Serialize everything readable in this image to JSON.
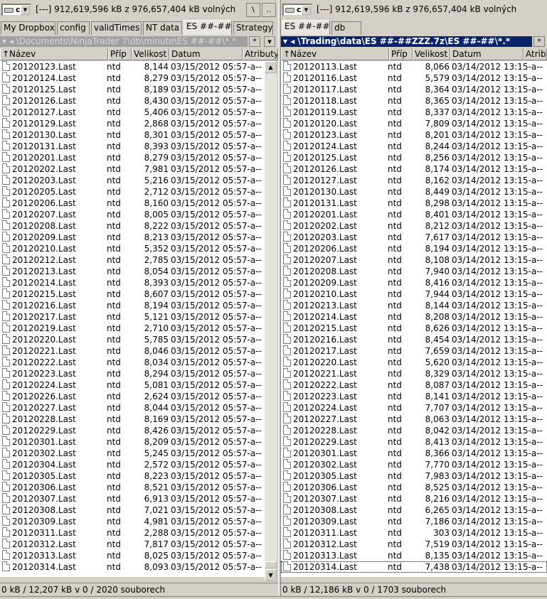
{
  "left": {
    "drive": "c",
    "drive_info": "[---]  912,619,596 kB z 976,657,404 kB volných",
    "btn_root": "\\",
    "btn_up": "..",
    "tabs": [
      "My Dropbox",
      "config",
      "validTimes",
      "NT data",
      "ES ##-##",
      "Strategy"
    ],
    "active_tab": 4,
    "path": "▾ ◂ \\Documents\\NinjaTrader 7\\db\\minute\\ES ##-##\\*.*",
    "btn_star": "*",
    "btn_dropdown": "▾",
    "headers": {
      "name": "↑Název",
      "ext": "Příp",
      "size": "Velikost",
      "date": "Datum",
      "attr": "Atributy"
    },
    "rows": [
      [
        "20120123.Last",
        "ntd",
        "8,144",
        "03/15/2012 05:57-a--"
      ],
      [
        "20120124.Last",
        "ntd",
        "8,279",
        "03/15/2012 05:57-a--"
      ],
      [
        "20120125.Last",
        "ntd",
        "8,189",
        "03/15/2012 05:57-a--"
      ],
      [
        "20120126.Last",
        "ntd",
        "8,430",
        "03/15/2012 05:57-a--"
      ],
      [
        "20120127.Last",
        "ntd",
        "5,406",
        "03/15/2012 05:57-a--"
      ],
      [
        "20120129.Last",
        "ntd",
        "2,868",
        "03/15/2012 05:57-a--"
      ],
      [
        "20120130.Last",
        "ntd",
        "8,301",
        "03/15/2012 05:57-a--"
      ],
      [
        "20120131.Last",
        "ntd",
        "8,393",
        "03/15/2012 05:57-a--"
      ],
      [
        "20120201.Last",
        "ntd",
        "8,279",
        "03/15/2012 05:57-a--"
      ],
      [
        "20120202.Last",
        "ntd",
        "7,981",
        "03/15/2012 05:57-a--"
      ],
      [
        "20120203.Last",
        "ntd",
        "5,216",
        "03/15/2012 05:57-a--"
      ],
      [
        "20120205.Last",
        "ntd",
        "2,712",
        "03/15/2012 05:57-a--"
      ],
      [
        "20120206.Last",
        "ntd",
        "8,160",
        "03/15/2012 05:57-a--"
      ],
      [
        "20120207.Last",
        "ntd",
        "8,005",
        "03/15/2012 05:57-a--"
      ],
      [
        "20120208.Last",
        "ntd",
        "8,222",
        "03/15/2012 05:57-a--"
      ],
      [
        "20120209.Last",
        "ntd",
        "8,213",
        "03/15/2012 05:57-a--"
      ],
      [
        "20120210.Last",
        "ntd",
        "5,352",
        "03/15/2012 05:57-a--"
      ],
      [
        "20120212.Last",
        "ntd",
        "2,785",
        "03/15/2012 05:57-a--"
      ],
      [
        "20120213.Last",
        "ntd",
        "8,054",
        "03/15/2012 05:57-a--"
      ],
      [
        "20120214.Last",
        "ntd",
        "8,393",
        "03/15/2012 05:57-a--"
      ],
      [
        "20120215.Last",
        "ntd",
        "8,607",
        "03/15/2012 05:57-a--"
      ],
      [
        "20120216.Last",
        "ntd",
        "8,194",
        "03/15/2012 05:57-a--"
      ],
      [
        "20120217.Last",
        "ntd",
        "5,121",
        "03/15/2012 05:57-a--"
      ],
      [
        "20120219.Last",
        "ntd",
        "2,710",
        "03/15/2012 05:57-a--"
      ],
      [
        "20120220.Last",
        "ntd",
        "5,785",
        "03/15/2012 05:57-a--"
      ],
      [
        "20120221.Last",
        "ntd",
        "8,046",
        "03/15/2012 05:57-a--"
      ],
      [
        "20120222.Last",
        "ntd",
        "8,034",
        "03/15/2012 05:57-a--"
      ],
      [
        "20120223.Last",
        "ntd",
        "8,294",
        "03/15/2012 05:57-a--"
      ],
      [
        "20120224.Last",
        "ntd",
        "5,081",
        "03/15/2012 05:57-a--"
      ],
      [
        "20120226.Last",
        "ntd",
        "2,624",
        "03/15/2012 05:57-a--"
      ],
      [
        "20120227.Last",
        "ntd",
        "8,044",
        "03/15/2012 05:57-a--"
      ],
      [
        "20120228.Last",
        "ntd",
        "8,169",
        "03/15/2012 05:57-a--"
      ],
      [
        "20120229.Last",
        "ntd",
        "8,426",
        "03/15/2012 05:57-a--"
      ],
      [
        "20120301.Last",
        "ntd",
        "8,209",
        "03/15/2012 05:57-a--"
      ],
      [
        "20120302.Last",
        "ntd",
        "5,245",
        "03/15/2012 05:57-a--"
      ],
      [
        "20120304.Last",
        "ntd",
        "2,572",
        "03/15/2012 05:57-a--"
      ],
      [
        "20120305.Last",
        "ntd",
        "8,223",
        "03/15/2012 05:57-a--"
      ],
      [
        "20120306.Last",
        "ntd",
        "8,521",
        "03/15/2012 05:57-a--"
      ],
      [
        "20120307.Last",
        "ntd",
        "6,913",
        "03/15/2012 05:57-a--"
      ],
      [
        "20120308.Last",
        "ntd",
        "7,021",
        "03/15/2012 05:57-a--"
      ],
      [
        "20120309.Last",
        "ntd",
        "4,981",
        "03/15/2012 05:57-a--"
      ],
      [
        "20120311.Last",
        "ntd",
        "2,288",
        "03/15/2012 05:57-a--"
      ],
      [
        "20120312.Last",
        "ntd",
        "7,817",
        "03/15/2012 05:57-a--"
      ],
      [
        "20120313.Last",
        "ntd",
        "8,025",
        "03/15/2012 05:57-a--"
      ],
      [
        "20120314.Last",
        "ntd",
        "8,093",
        "03/15/2012 05:57-a--"
      ]
    ],
    "status": "0 kB / 12,207 kB v 0 / 2020 souborech"
  },
  "right": {
    "drive": "c",
    "drive_info": "[---]  912,619,596 kB z 976,657,404 kB volných",
    "tabs": [
      "ES ##-##",
      "db"
    ],
    "active_tab": 0,
    "path": "▾ ◂ \\Trading\\data\\ES ##-##ZZZ.7z\\ES ##-##\\*.*",
    "btn_star": "*",
    "headers": {
      "name": "↑Název",
      "ext": "Příp",
      "size": "Velikost",
      "date": "Datum",
      "attr": "Atrib"
    },
    "rows": [
      [
        "20120113.Last",
        "ntd",
        "8,066",
        "03/14/2012 13:15-a--"
      ],
      [
        "20120116.Last",
        "ntd",
        "5,579",
        "03/14/2012 13:15-a--"
      ],
      [
        "20120117.Last",
        "ntd",
        "8,364",
        "03/14/2012 13:15-a--"
      ],
      [
        "20120118.Last",
        "ntd",
        "8,365",
        "03/14/2012 13:15-a--"
      ],
      [
        "20120119.Last",
        "ntd",
        "8,337",
        "03/14/2012 13:15-a--"
      ],
      [
        "20120120.Last",
        "ntd",
        "7,809",
        "03/14/2012 13:15-a--"
      ],
      [
        "20120123.Last",
        "ntd",
        "8,201",
        "03/14/2012 13:15-a--"
      ],
      [
        "20120124.Last",
        "ntd",
        "8,244",
        "03/14/2012 13:15-a--"
      ],
      [
        "20120125.Last",
        "ntd",
        "8,256",
        "03/14/2012 13:15-a--"
      ],
      [
        "20120126.Last",
        "ntd",
        "8,174",
        "03/14/2012 13:15-a--"
      ],
      [
        "20120127.Last",
        "ntd",
        "8,162",
        "03/14/2012 13:15-a--"
      ],
      [
        "20120130.Last",
        "ntd",
        "8,449",
        "03/14/2012 13:15-a--"
      ],
      [
        "20120131.Last",
        "ntd",
        "8,298",
        "03/14/2012 13:15-a--"
      ],
      [
        "20120201.Last",
        "ntd",
        "8,401",
        "03/14/2012 13:15-a--"
      ],
      [
        "20120202.Last",
        "ntd",
        "8,212",
        "03/14/2012 13:15-a--"
      ],
      [
        "20120203.Last",
        "ntd",
        "7,617",
        "03/14/2012 13:15-a--"
      ],
      [
        "20120206.Last",
        "ntd",
        "8,194",
        "03/14/2012 13:15-a--"
      ],
      [
        "20120207.Last",
        "ntd",
        "8,108",
        "03/14/2012 13:15-a--"
      ],
      [
        "20120208.Last",
        "ntd",
        "7,940",
        "03/14/2012 13:15-a--"
      ],
      [
        "20120209.Last",
        "ntd",
        "8,416",
        "03/14/2012 13:15-a--"
      ],
      [
        "20120210.Last",
        "ntd",
        "7,944",
        "03/14/2012 13:15-a--"
      ],
      [
        "20120213.Last",
        "ntd",
        "8,144",
        "03/14/2012 13:15-a--"
      ],
      [
        "20120214.Last",
        "ntd",
        "8,208",
        "03/14/2012 13:15-a--"
      ],
      [
        "20120215.Last",
        "ntd",
        "8,626",
        "03/14/2012 13:15-a--"
      ],
      [
        "20120216.Last",
        "ntd",
        "8,454",
        "03/14/2012 13:15-a--"
      ],
      [
        "20120217.Last",
        "ntd",
        "7,659",
        "03/14/2012 13:15-a--"
      ],
      [
        "20120220.Last",
        "ntd",
        "5,620",
        "03/14/2012 13:15-a--"
      ],
      [
        "20120221.Last",
        "ntd",
        "8,329",
        "03/14/2012 13:15-a--"
      ],
      [
        "20120222.Last",
        "ntd",
        "8,087",
        "03/14/2012 13:15-a--"
      ],
      [
        "20120223.Last",
        "ntd",
        "8,141",
        "03/14/2012 13:15-a--"
      ],
      [
        "20120224.Last",
        "ntd",
        "7,707",
        "03/14/2012 13:15-a--"
      ],
      [
        "20120227.Last",
        "ntd",
        "8,063",
        "03/14/2012 13:15-a--"
      ],
      [
        "20120228.Last",
        "ntd",
        "8,042",
        "03/14/2012 13:15-a--"
      ],
      [
        "20120229.Last",
        "ntd",
        "8,413",
        "03/14/2012 13:15-a--"
      ],
      [
        "20120301.Last",
        "ntd",
        "8,366",
        "03/14/2012 13:15-a--"
      ],
      [
        "20120302.Last",
        "ntd",
        "7,770",
        "03/14/2012 13:15-a--"
      ],
      [
        "20120305.Last",
        "ntd",
        "7,983",
        "03/14/2012 13:15-a--"
      ],
      [
        "20120306.Last",
        "ntd",
        "8,525",
        "03/14/2012 13:15-a--"
      ],
      [
        "20120307.Last",
        "ntd",
        "8,216",
        "03/14/2012 13:15-a--"
      ],
      [
        "20120308.Last",
        "ntd",
        "6,265",
        "03/14/2012 13:15-a--"
      ],
      [
        "20120309.Last",
        "ntd",
        "7,186",
        "03/14/2012 13:15-a--"
      ],
      [
        "20120311.Last",
        "ntd",
        "303",
        "03/14/2012 13:15-a--"
      ],
      [
        "20120312.Last",
        "ntd",
        "7,519",
        "03/14/2012 13:15-a--"
      ],
      [
        "20120313.Last",
        "ntd",
        "8,135",
        "03/14/2012 13:15-a--"
      ],
      [
        "20120314.Last",
        "ntd",
        "7,438",
        "03/14/2012 13:15-a--"
      ]
    ],
    "status": "0 kB / 12,186 kB v 0 / 1703 souborech"
  }
}
